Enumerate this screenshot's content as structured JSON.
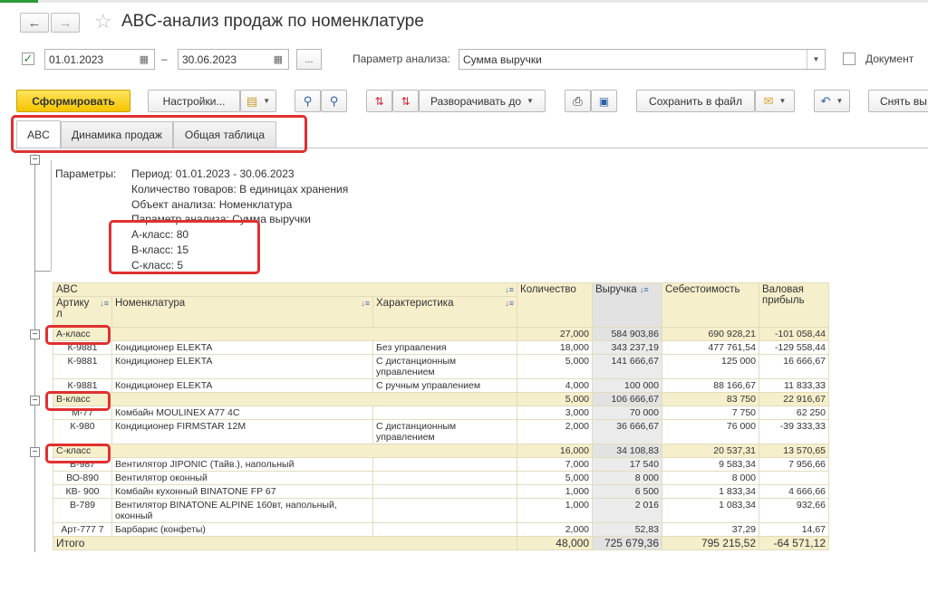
{
  "window": {
    "title": "ABC-анализ продаж по номенклатуре"
  },
  "params": {
    "date_from": "01.01.2023",
    "date_sep": "–",
    "date_to": "30.06.2023",
    "ellipsis": "...",
    "analysis_param_label": "Параметр анализа:",
    "analysis_param_value": "Сумма выручки",
    "document_label": "Документ"
  },
  "toolbar": {
    "generate": "Сформировать",
    "settings": "Настройки...",
    "expand_to": "Разворачивать до",
    "save_file": "Сохранить в файл",
    "remove": "Снять вы"
  },
  "tabs": [
    "ABC",
    "Динамика продаж",
    "Общая таблица"
  ],
  "report": {
    "params_label": "Параметры:",
    "lines": [
      "Период: 01.01.2023 - 30.06.2023",
      "Количество товаров: В единицах хранения",
      "Объект анализа: Номенклатура",
      "Параметр анализа: Сумма выручки",
      "А-класс: 80",
      "B-класс: 15",
      "С-класс: 5"
    ]
  },
  "table": {
    "headers": {
      "abc": "ABC",
      "article": "Артику",
      "article_cut": "л",
      "nomenclature": "Номенклатура",
      "characteristic": "Характеристика",
      "quantity": "Количество",
      "revenue": "Выручка",
      "cost": "Себестоимость",
      "gross1": "Валовая",
      "gross2": "прибыль"
    },
    "groups": [
      {
        "name": "A-класс",
        "qty": "27,000",
        "rev": "584 903,86",
        "cost": "690 928,21",
        "profit": "-101 058,44",
        "rows": [
          {
            "art": "К-9881",
            "name": "Кондиционер ELEKTA",
            "char": "Без управления",
            "qty": "18,000",
            "rev": "343 237,19",
            "cost": "477 761,54",
            "profit": "-129 558,44"
          },
          {
            "art": "К-9881",
            "name": "Кондиционер ELEKTA",
            "char": "С дистанционным управлением",
            "qty": "5,000",
            "rev": "141 666,67",
            "cost": "125 000",
            "profit": "16 666,67"
          },
          {
            "art": "К-9881",
            "name": "Кондиционер ELEKTA",
            "char": "С ручным управлением",
            "qty": "4,000",
            "rev": "100 000",
            "cost": "88 166,67",
            "profit": "11 833,33"
          }
        ]
      },
      {
        "name": "B-класс",
        "qty": "5,000",
        "rev": "106 666,67",
        "cost": "83 750",
        "profit": "22 916,67",
        "rows": [
          {
            "art": "М-77",
            "name": "Комбайн MOULINEX A77 4C",
            "char": "",
            "qty": "3,000",
            "rev": "70 000",
            "cost": "7 750",
            "profit": "62 250"
          },
          {
            "art": "К-980",
            "name": "Кондиционер FIRMSTAR 12M",
            "char": "С дистанционным управлением",
            "qty": "2,000",
            "rev": "36 666,67",
            "cost": "76 000",
            "profit": "-39 333,33"
          }
        ]
      },
      {
        "name": "C-класс",
        "qty": "16,000",
        "rev": "34 108,83",
        "cost": "20 537,31",
        "profit": "13 570,65",
        "rows": [
          {
            "art": "В-987",
            "name": "Вентилятор JIPONIC (Тайв.), напольный",
            "char": "",
            "qty": "7,000",
            "rev": "17 540",
            "cost": "9 583,34",
            "profit": "7 956,66"
          },
          {
            "art": "ВО-890",
            "name": "Вентилятор оконный",
            "char": "",
            "qty": "5,000",
            "rev": "8 000",
            "cost": "8 000",
            "profit": ""
          },
          {
            "art": "КВ- 900",
            "name": "Комбайн кухонный BINATONE FP 67",
            "char": "",
            "qty": "1,000",
            "rev": "6 500",
            "cost": "1 833,34",
            "profit": "4 666,66"
          },
          {
            "art": "В-789",
            "name": "Вентилятор BINATONE ALPINE 160вт, напольный, оконный",
            "char": "",
            "qty": "1,000",
            "rev": "2 016",
            "cost": "1 083,34",
            "profit": "932,66"
          },
          {
            "art": "Арт-777 7",
            "name": "Барбарис (конфеты)",
            "char": "",
            "qty": "2,000",
            "rev": "52,83",
            "cost": "37,29",
            "profit": "14,67"
          }
        ]
      }
    ],
    "total": {
      "label": "Итого",
      "qty": "48,000",
      "rev": "725 679,36",
      "cost": "795 215,52",
      "profit": "-64 571,12"
    }
  }
}
